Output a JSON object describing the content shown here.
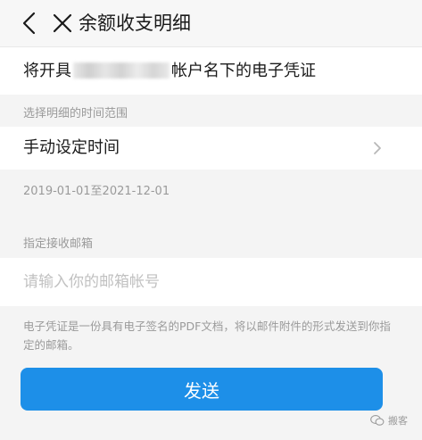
{
  "header": {
    "title": "余额收支明细",
    "back_icon": "chevron-left-icon",
    "close_icon": "close-icon"
  },
  "notice": {
    "prefix": "将开具",
    "suffix": "帐户名下的电子凭证"
  },
  "time_section": {
    "label": "选择明细的时间范围",
    "option_label": "手动设定时间",
    "date_range": "2019-01-01至2021-12-01"
  },
  "email_section": {
    "label": "指定接收邮箱",
    "placeholder": "请输入你的邮箱帐号",
    "value": ""
  },
  "description": "电子凭证是一份具有电子签名的PDF文档，将以邮件附件的形式发送到你指定的邮箱。",
  "send_button": "发送",
  "watermark": "搬客",
  "colors": {
    "primary_button": "#1d8fe8",
    "background": "#f4f4f4",
    "secondary_text": "#9a9a9a",
    "placeholder": "#c1c1c1"
  }
}
